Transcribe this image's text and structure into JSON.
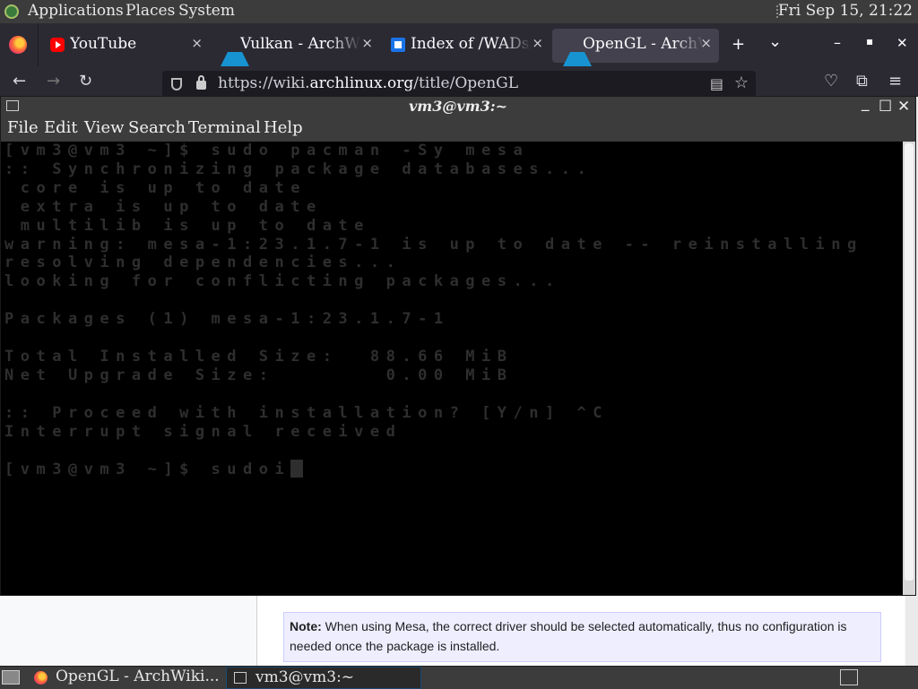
{
  "top_panel": {
    "menus": [
      "Applications",
      "Places",
      "System"
    ],
    "clock": "Fri Sep 15, 21:22"
  },
  "browser": {
    "tabs": [
      {
        "label": "YouTube",
        "icon": "youtube-icon",
        "close": "×"
      },
      {
        "label": "Vulkan - ArchWiki",
        "icon": "archlinux-icon",
        "close": "×"
      },
      {
        "label": "Index of /WADs/",
        "icon": "index-page-icon",
        "close": "×"
      },
      {
        "label": "OpenGL - ArchWiki",
        "icon": "archlinux-icon",
        "close": "×",
        "active": true
      }
    ],
    "new_tab": "+",
    "tab_list": "⌄",
    "win_min": "–",
    "win_max": "▪",
    "win_close": "✕",
    "nav": {
      "back": "←",
      "forward": "→",
      "reload": "↻"
    },
    "url_prefix": "https://wiki.",
    "url_domain": "archlinux.org",
    "url_path": "/title/OpenGL",
    "reader": "▤",
    "bookmark": "☆",
    "pocket": "♡",
    "extensions": "⧉",
    "menu": "≡"
  },
  "page": {
    "note_label": "Note:",
    "note_text": "When using Mesa, the correct driver should be selected automatically, thus no configuration is needed once the package is installed."
  },
  "terminal": {
    "title": "vm3@vm3:~",
    "win_min": "_",
    "win_max": "☐",
    "win_close": "✕",
    "menu": [
      "File",
      "Edit",
      "View",
      "Search",
      "Terminal",
      "Help"
    ],
    "lines": [
      "[vm3@vm3 ~]$ sudo pacman -Sy mesa",
      ":: Synchronizing package databases...",
      " core is up to date",
      " extra is up to date",
      " multilib is up to date",
      "warning: mesa-1:23.1.7-1 is up to date -- reinstalling",
      "resolving dependencies...",
      "looking for conflicting packages...",
      "",
      "Packages (1) mesa-1:23.1.7-1",
      "",
      "Total Installed Size:  88.66 MiB",
      "Net Upgrade Size:       0.00 MiB",
      "",
      ":: Proceed with installation? [Y/n] ^C",
      "Interrupt signal received",
      "",
      "[vm3@vm3 ~]$ sudoi"
    ]
  },
  "taskbar": {
    "items": [
      {
        "label": "OpenGL - ArchWiki..."
      },
      {
        "label": "vm3@vm3:~",
        "active": true
      }
    ]
  },
  "colors": {
    "panel": "#3c3c3c",
    "firefox_chrome": "#2b2a33",
    "terminal_bg": "#000000",
    "terminal_text": "#2e2e2e",
    "note_bg": "#eeeeff"
  }
}
